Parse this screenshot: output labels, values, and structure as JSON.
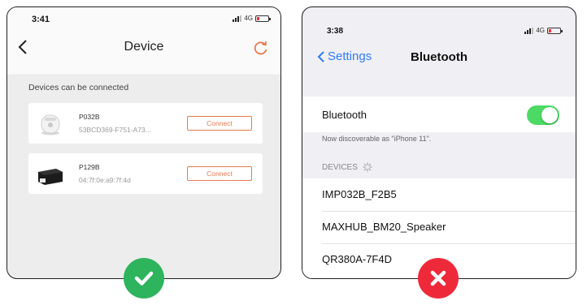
{
  "left_phone": {
    "status_time": "3:41",
    "network": "4G",
    "nav_title": "Device",
    "section_label": "Devices can be connected",
    "devices": [
      {
        "name": "P032B",
        "id": "53BCD369-F751-A73...",
        "button": "Connect"
      },
      {
        "name": "P129B",
        "id": "04:7f:0e:a9:7f:4d",
        "button": "Connect"
      }
    ],
    "accent_color": "#e8794f"
  },
  "right_phone": {
    "status_time": "3:38",
    "network": "4G",
    "back_label": "Settings",
    "nav_title": "Bluetooth",
    "bluetooth_label": "Bluetooth",
    "bluetooth_on": true,
    "discoverable_text": "Now discoverable as \"iPhone 11\".",
    "devices_header": "DEVICES",
    "devices": [
      "IMP032B_F2B5",
      "MAXHUB_BM20_Speaker",
      "QR380A-7F4D"
    ],
    "accent_color": "#2f7cf6",
    "toggle_color": "#4cd964"
  },
  "badges": {
    "left": {
      "icon": "check-icon",
      "color": "#2db45d"
    },
    "right": {
      "icon": "x-icon",
      "color": "#ee2a3a"
    }
  }
}
